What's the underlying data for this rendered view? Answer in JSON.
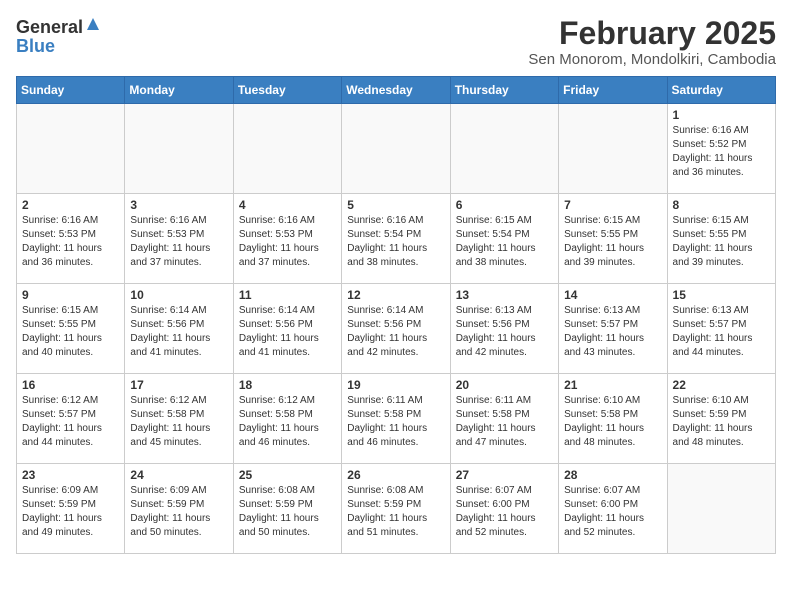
{
  "header": {
    "logo_general": "General",
    "logo_blue": "Blue",
    "title": "February 2025",
    "subtitle": "Sen Monorom, Mondolkiri, Cambodia"
  },
  "days_of_week": [
    "Sunday",
    "Monday",
    "Tuesday",
    "Wednesday",
    "Thursday",
    "Friday",
    "Saturday"
  ],
  "weeks": [
    [
      {
        "day": "",
        "info": ""
      },
      {
        "day": "",
        "info": ""
      },
      {
        "day": "",
        "info": ""
      },
      {
        "day": "",
        "info": ""
      },
      {
        "day": "",
        "info": ""
      },
      {
        "day": "",
        "info": ""
      },
      {
        "day": "1",
        "info": "Sunrise: 6:16 AM\nSunset: 5:52 PM\nDaylight: 11 hours\nand 36 minutes."
      }
    ],
    [
      {
        "day": "2",
        "info": "Sunrise: 6:16 AM\nSunset: 5:53 PM\nDaylight: 11 hours\nand 36 minutes."
      },
      {
        "day": "3",
        "info": "Sunrise: 6:16 AM\nSunset: 5:53 PM\nDaylight: 11 hours\nand 37 minutes."
      },
      {
        "day": "4",
        "info": "Sunrise: 6:16 AM\nSunset: 5:53 PM\nDaylight: 11 hours\nand 37 minutes."
      },
      {
        "day": "5",
        "info": "Sunrise: 6:16 AM\nSunset: 5:54 PM\nDaylight: 11 hours\nand 38 minutes."
      },
      {
        "day": "6",
        "info": "Sunrise: 6:15 AM\nSunset: 5:54 PM\nDaylight: 11 hours\nand 38 minutes."
      },
      {
        "day": "7",
        "info": "Sunrise: 6:15 AM\nSunset: 5:55 PM\nDaylight: 11 hours\nand 39 minutes."
      },
      {
        "day": "8",
        "info": "Sunrise: 6:15 AM\nSunset: 5:55 PM\nDaylight: 11 hours\nand 39 minutes."
      }
    ],
    [
      {
        "day": "9",
        "info": "Sunrise: 6:15 AM\nSunset: 5:55 PM\nDaylight: 11 hours\nand 40 minutes."
      },
      {
        "day": "10",
        "info": "Sunrise: 6:14 AM\nSunset: 5:56 PM\nDaylight: 11 hours\nand 41 minutes."
      },
      {
        "day": "11",
        "info": "Sunrise: 6:14 AM\nSunset: 5:56 PM\nDaylight: 11 hours\nand 41 minutes."
      },
      {
        "day": "12",
        "info": "Sunrise: 6:14 AM\nSunset: 5:56 PM\nDaylight: 11 hours\nand 42 minutes."
      },
      {
        "day": "13",
        "info": "Sunrise: 6:13 AM\nSunset: 5:56 PM\nDaylight: 11 hours\nand 42 minutes."
      },
      {
        "day": "14",
        "info": "Sunrise: 6:13 AM\nSunset: 5:57 PM\nDaylight: 11 hours\nand 43 minutes."
      },
      {
        "day": "15",
        "info": "Sunrise: 6:13 AM\nSunset: 5:57 PM\nDaylight: 11 hours\nand 44 minutes."
      }
    ],
    [
      {
        "day": "16",
        "info": "Sunrise: 6:12 AM\nSunset: 5:57 PM\nDaylight: 11 hours\nand 44 minutes."
      },
      {
        "day": "17",
        "info": "Sunrise: 6:12 AM\nSunset: 5:58 PM\nDaylight: 11 hours\nand 45 minutes."
      },
      {
        "day": "18",
        "info": "Sunrise: 6:12 AM\nSunset: 5:58 PM\nDaylight: 11 hours\nand 46 minutes."
      },
      {
        "day": "19",
        "info": "Sunrise: 6:11 AM\nSunset: 5:58 PM\nDaylight: 11 hours\nand 46 minutes."
      },
      {
        "day": "20",
        "info": "Sunrise: 6:11 AM\nSunset: 5:58 PM\nDaylight: 11 hours\nand 47 minutes."
      },
      {
        "day": "21",
        "info": "Sunrise: 6:10 AM\nSunset: 5:58 PM\nDaylight: 11 hours\nand 48 minutes."
      },
      {
        "day": "22",
        "info": "Sunrise: 6:10 AM\nSunset: 5:59 PM\nDaylight: 11 hours\nand 48 minutes."
      }
    ],
    [
      {
        "day": "23",
        "info": "Sunrise: 6:09 AM\nSunset: 5:59 PM\nDaylight: 11 hours\nand 49 minutes."
      },
      {
        "day": "24",
        "info": "Sunrise: 6:09 AM\nSunset: 5:59 PM\nDaylight: 11 hours\nand 50 minutes."
      },
      {
        "day": "25",
        "info": "Sunrise: 6:08 AM\nSunset: 5:59 PM\nDaylight: 11 hours\nand 50 minutes."
      },
      {
        "day": "26",
        "info": "Sunrise: 6:08 AM\nSunset: 5:59 PM\nDaylight: 11 hours\nand 51 minutes."
      },
      {
        "day": "27",
        "info": "Sunrise: 6:07 AM\nSunset: 6:00 PM\nDaylight: 11 hours\nand 52 minutes."
      },
      {
        "day": "28",
        "info": "Sunrise: 6:07 AM\nSunset: 6:00 PM\nDaylight: 11 hours\nand 52 minutes."
      },
      {
        "day": "",
        "info": ""
      }
    ]
  ]
}
